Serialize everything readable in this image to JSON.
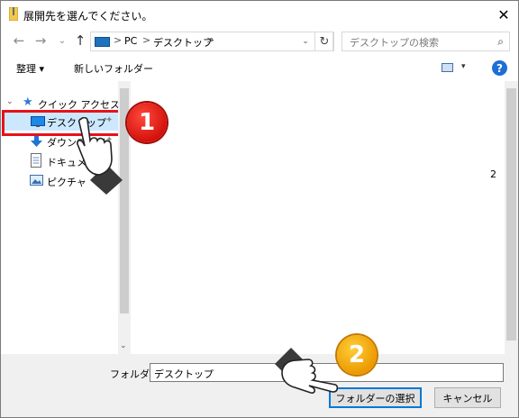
{
  "window": {
    "title": "展開先を選んでください。",
    "close_glyph": "✕"
  },
  "nav": {
    "back_glyph": "←",
    "forward_glyph": "→",
    "recent_glyph": "⌄",
    "up_glyph": "↑",
    "address": {
      "segments": [
        "PC",
        "デスクトップ"
      ],
      "chevron": ">",
      "dropdown_glyph": "⌄",
      "refresh_glyph": "↻"
    },
    "search": {
      "placeholder": "デスクトップの検索",
      "icon": "search-icon",
      "glyph": "⌕"
    }
  },
  "toolbar": {
    "organize_label": "整理 ▾",
    "new_folder_label": "新しいフォルダー",
    "view_dropdown_glyph": "▾",
    "help_glyph": "?"
  },
  "sidebar": {
    "quick_access_label": "クイック アクセス",
    "items": [
      {
        "label": "デスクトップ",
        "icon": "desktop-icon",
        "pinned": true
      },
      {
        "label": "ダウンロード",
        "icon": "download-icon",
        "pinned": true
      },
      {
        "label": "ドキュメント",
        "icon": "document-icon",
        "pinned": true
      },
      {
        "label": "ピクチャ",
        "icon": "pictures-icon",
        "pinned": false
      }
    ],
    "pin_glyph": "📌"
  },
  "content": {
    "stray_text": "2"
  },
  "footer": {
    "folder_label": "フォルダー:",
    "folder_value": "デスクトップ",
    "select_button": "フォルダーの選択",
    "cancel_button": "キャンセル"
  },
  "annotations": {
    "step1": "1",
    "step2": "2"
  },
  "colors": {
    "highlight_border": "#e8111b",
    "selected_bg": "#cce8ff",
    "step1_badge": "#d3120c",
    "step2_badge": "#ec9a00",
    "accent": "#0078d7"
  }
}
